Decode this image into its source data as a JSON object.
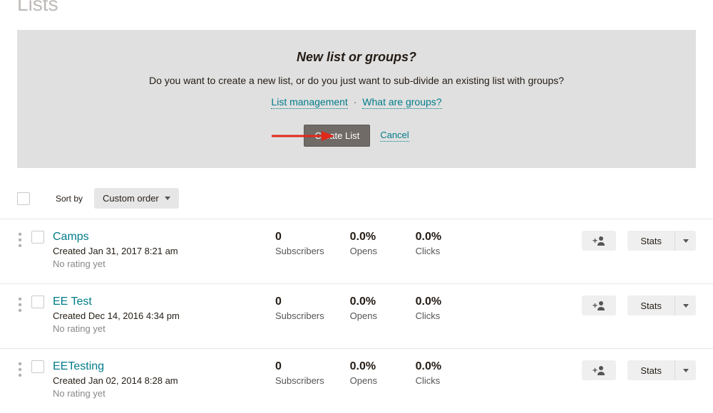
{
  "page_title": "Lists",
  "prompt": {
    "title": "New list or groups?",
    "text": "Do you want to create a new list, or do you just want to sub-divide an existing list with groups?",
    "link_management": "List management",
    "link_groups": "What are groups?",
    "btn_create": "Create List",
    "link_cancel": "Cancel"
  },
  "toolbar": {
    "sort_label": "Sort by",
    "sort_value": "Custom order"
  },
  "labels": {
    "subscribers": "Subscribers",
    "opens": "Opens",
    "clicks": "Clicks",
    "stats": "Stats",
    "created_prefix": "Created ",
    "no_rating": "No rating yet"
  },
  "lists": [
    {
      "name": "Camps",
      "created": "Jan 31, 2017 8:21 am",
      "subscribers": "0",
      "opens": "0.0%",
      "clicks": "0.0%"
    },
    {
      "name": "EE Test",
      "created": "Dec 14, 2016 4:34 pm",
      "subscribers": "0",
      "opens": "0.0%",
      "clicks": "0.0%"
    },
    {
      "name": "EETesting",
      "created": "Jan 02, 2014 8:28 am",
      "subscribers": "0",
      "opens": "0.0%",
      "clicks": "0.0%"
    }
  ]
}
